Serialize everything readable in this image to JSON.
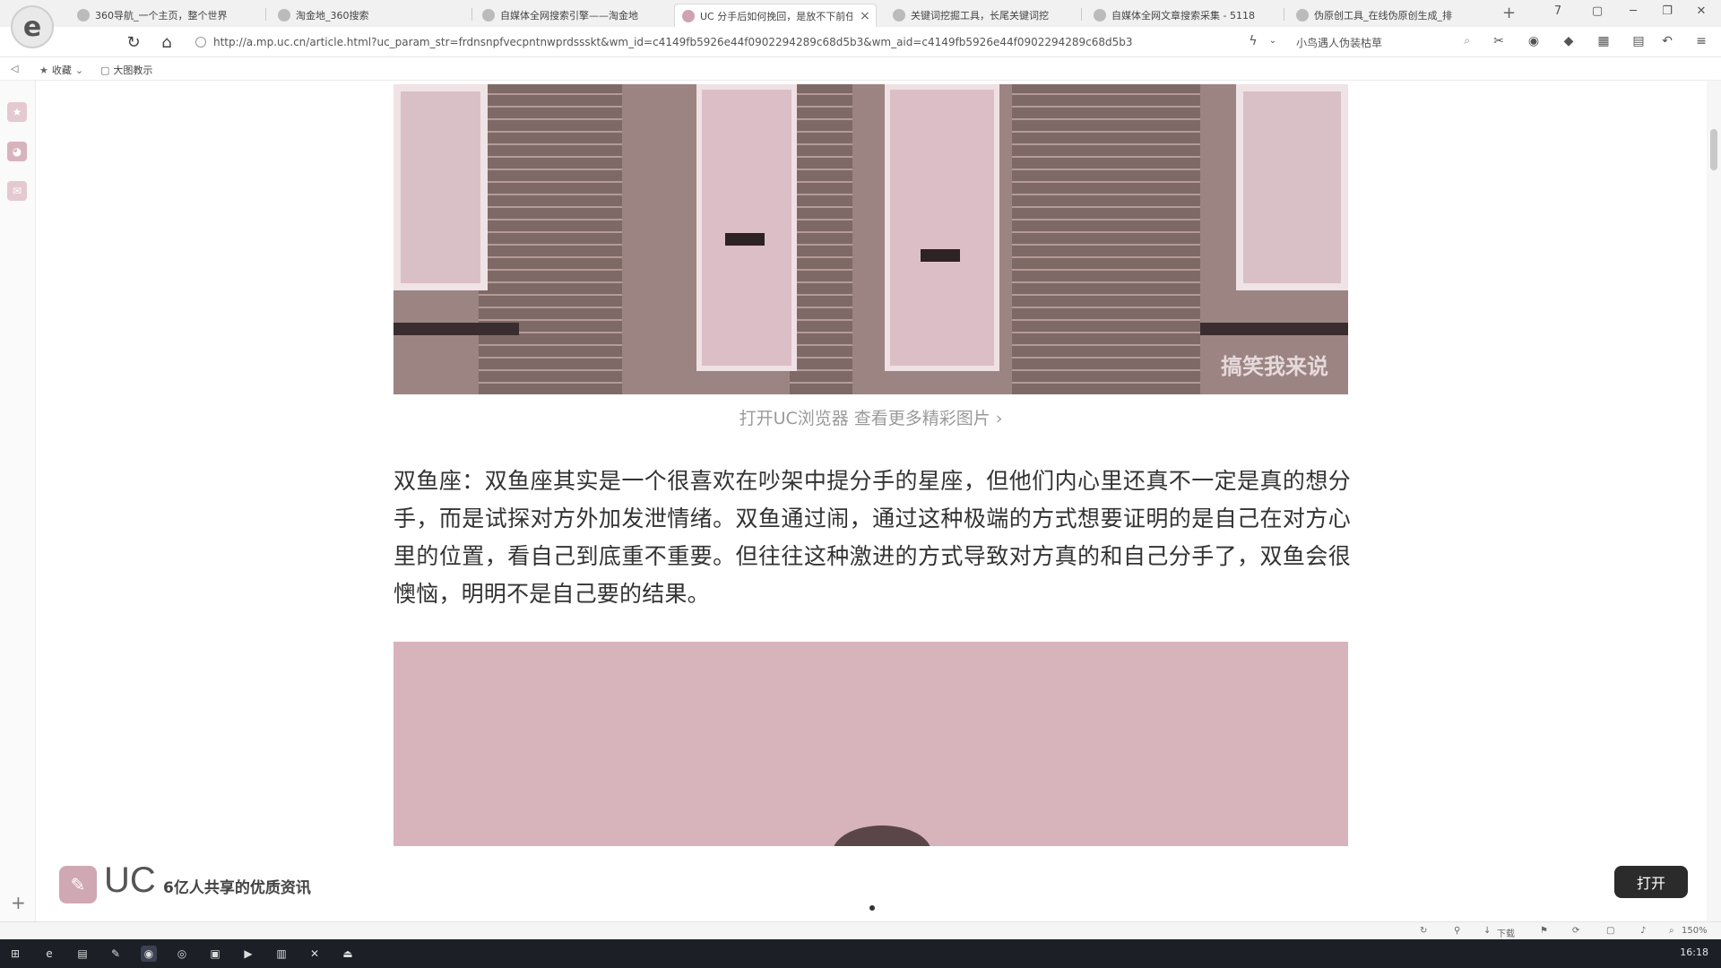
{
  "browser": {
    "logo_glyph": "e",
    "tabs": [
      {
        "label": "360导航_一个主页，整个世界",
        "active": false
      },
      {
        "label": "淘金地_360搜索",
        "active": false
      },
      {
        "label": "自媒体全网搜索引擎——淘金地",
        "active": false
      },
      {
        "label": "UC 分手后如何挽回，是放不下前任",
        "active": true
      },
      {
        "label": "关键词挖掘工具，长尾关键词挖",
        "active": false
      },
      {
        "label": "自媒体全网文章搜索采集 - 5118",
        "active": false
      },
      {
        "label": "伪原创工具_在线伪原创生成_排",
        "active": false
      }
    ],
    "active_tab_close": "×",
    "new_tab": "+",
    "window_controls": [
      "7",
      "▢",
      "─",
      "❐",
      "✕"
    ],
    "nav": {
      "back": "‹",
      "reload": "↻",
      "home": "⌂"
    },
    "url": "http://a.mp.uc.cn/article.html?uc_param_str=frdnsnpfvecpntnwprdssskt&wm_id=c4149fb5926e44f0902294289c68d5b3&wm_aid=c4149fb5926e44f0902294289c68d5b3",
    "search_text": "小鸟遇人伪装枯草",
    "toolbar_icons": [
      "cut-icon",
      "shield-icon",
      "extension-icon",
      "screenshot-icon",
      "apps-icon",
      "undo-icon",
      "menu-icon"
    ],
    "bookmarks": [
      {
        "label": "收藏"
      },
      {
        "label": "大图教示"
      }
    ]
  },
  "sidebar": {
    "icons": [
      "star-icon",
      "weibo-icon",
      "mail-icon"
    ],
    "add": "+"
  },
  "article": {
    "image_top_watermark": "搞笑我来说",
    "caption_link": "打开UC浏览器 查看更多精彩图片 ›",
    "paragraph": "双鱼座：双鱼座其实是一个很喜欢在吵架中提分手的星座，但他们内心里还真不一定是真的想分手，而是试探对方外加发泄情绪。双鱼通过闹，通过这种极端的方式想要证明的是自己在对方心里的位置，看自己到底重不重要。但往往这种激进的方式导致对方真的和自己分手了，双鱼会很懊恼，明明不是自己要的结果。"
  },
  "uc_banner": {
    "brand": "UC",
    "slogan": "6亿人共享的优质资讯",
    "open_button": "打开"
  },
  "statusbar": {
    "download": "下载",
    "zoom": "150%"
  },
  "taskbar": {
    "clock": "16:18"
  },
  "colors": {
    "image_tint": "#d7b3bc",
    "open_button_bg": "#2b2b2b",
    "taskbar_bg": "#1c1f26"
  }
}
